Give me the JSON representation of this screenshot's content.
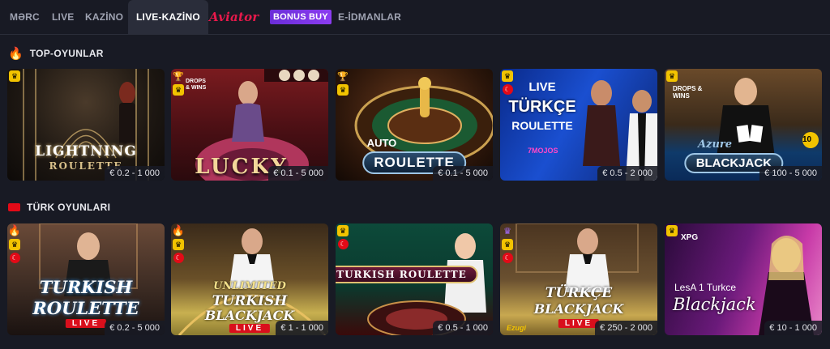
{
  "nav": {
    "items": [
      "MƏRC",
      "LIVE",
      "KAZİNO",
      "LIVE-KAZİNO",
      "Aviator",
      "BONUS BUY",
      "E-İDMANLAR"
    ],
    "active": "LIVE-KAZİNO"
  },
  "sections": [
    {
      "title": "TOP-OYUNLAR",
      "icon": "fire-icon",
      "cards": [
        {
          "title": "LIGHTNING",
          "subtitle": "ROULETTE",
          "price": "€ 0.2 - 1 000",
          "badges": [
            "crown-icon"
          ]
        },
        {
          "title": "LUCKY",
          "price": "€ 0.1 - 5 000",
          "badges": [
            "trophy-icon",
            "crown-icon"
          ],
          "tag": "DROPS & WINS"
        },
        {
          "title": "ROULETTE",
          "prefix": "AUTO",
          "price": "€ 0.1 - 5 000",
          "badges": [
            "trophy-icon",
            "crown-icon"
          ]
        },
        {
          "title": "TÜRKÇE",
          "subtitle": "ROULETTE",
          "prefix": "LIVE",
          "price": "€ 0.5 - 2 000",
          "badges": [
            "crown-icon",
            "flag-tr-icon"
          ],
          "studio": "7MOJOS"
        },
        {
          "title": "BLACKJACK",
          "prefix": "Azure",
          "price": "€ 100 - 5 000",
          "badges": [
            "crown-icon"
          ],
          "tag": "DROPS & WINS",
          "number": "10"
        }
      ]
    },
    {
      "title": "TÜRK OYUNLARI",
      "icon": "flag-tr-icon",
      "cards": [
        {
          "title": "TURKISH",
          "subtitle": "ROULETTE",
          "live": "LIVE",
          "price": "€ 0.2 - 5 000",
          "badges": [
            "fire-icon",
            "crown-icon",
            "flag-tr-icon"
          ]
        },
        {
          "title": "UNLIMITED",
          "subtitle": "TURKISH",
          "subtitle2": "BLACKJACK",
          "live": "LIVE",
          "price": "€ 1 - 1 000",
          "badges": [
            "fire-icon",
            "crown-icon",
            "flag-tr-icon"
          ]
        },
        {
          "title": "TURKISH ROULETTE",
          "price": "€ 0.5 - 1 000",
          "badges": [
            "crown-icon",
            "flag-tr-icon"
          ]
        },
        {
          "title": "TÜRKÇE",
          "subtitle": "BLACKJACK",
          "live": "LIVE",
          "price": "€ 250 - 2 000",
          "badges": [
            "purple-crown-icon",
            "crown-icon",
            "flag-tr-icon"
          ],
          "studio": "Ezugi"
        },
        {
          "title": "LesA 1 Turkce",
          "subtitle": "Blackjack",
          "price": "€ 10 - 1 000",
          "badges": [
            "crown-icon"
          ],
          "studio": "XPG"
        }
      ]
    }
  ],
  "colors": {
    "background": "#181a24",
    "active_tab": "#2a2d3a",
    "aviator": "#e8194b",
    "bonus_buy": "#7b35e6",
    "crown": "#f2c300"
  }
}
